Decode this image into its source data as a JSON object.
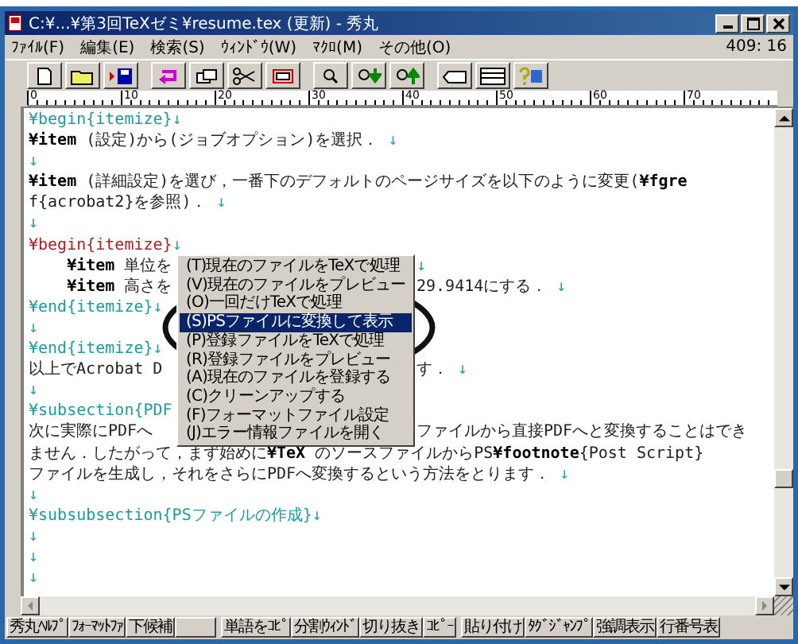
{
  "window": {
    "title": "C:¥...¥第3回TeXゼミ¥resume.tex (更新) - 秀丸"
  },
  "menu_bar": {
    "items": [
      "ﾌｧｲﾙ(F)",
      "編集(E)",
      "検索(S)",
      "ｳｨﾝﾄﾞｳ(W)",
      "ﾏｸﾛ(M)",
      "その他(O)"
    ],
    "position": "409: 16"
  },
  "ruler": {
    "marks": [
      "0",
      "10",
      "20",
      "30",
      "40",
      "50",
      "60",
      "70"
    ]
  },
  "editor": {
    "lines": [
      {
        "parts": [
          {
            "kind": "command",
            "text": "¥begin{itemize}"
          },
          {
            "kind": "return",
            "text": "↓"
          }
        ]
      },
      {
        "parts": [
          {
            "kind": "macro",
            "text": "¥item"
          },
          {
            "kind": "text",
            "text": " (設定)から(ジョブオプション)を選択． "
          },
          {
            "kind": "return",
            "text": "↓"
          }
        ]
      },
      {
        "parts": [
          {
            "kind": "return",
            "text": "↓"
          }
        ]
      },
      {
        "parts": [
          {
            "kind": "macro",
            "text": "¥item"
          },
          {
            "kind": "text",
            "text": " (詳細設定)を選び，一番下のデフォルトのページサイズを以下のように変更("
          },
          {
            "kind": "macro",
            "text": "¥fgre"
          }
        ]
      },
      {
        "parts": [
          {
            "kind": "text",
            "text": "f{acrobat2}を参照)． "
          },
          {
            "kind": "return",
            "text": "↓"
          }
        ]
      },
      {
        "parts": [
          {
            "kind": "return",
            "text": "↓"
          }
        ]
      },
      {
        "parts": [
          {
            "kind": "active",
            "text": "¥begin{itemize}"
          },
          {
            "kind": "return",
            "text": "↓"
          }
        ]
      },
      {
        "parts": [
          {
            "kind": "macro",
            "text": "    ¥item"
          },
          {
            "kind": "text",
            "text": " 単位を"
          }
        ],
        "after": [
          {
            "kind": "return",
            "text": "↓"
          }
        ]
      },
      {
        "parts": [
          {
            "kind": "macro",
            "text": "    ¥item"
          },
          {
            "kind": "text",
            "text": " 高さを"
          }
        ],
        "after": [
          {
            "kind": "text",
            "text": "29.9414にする． "
          },
          {
            "kind": "return",
            "text": "↓"
          }
        ]
      },
      {
        "parts": [
          {
            "kind": "command",
            "text": "¥end{itemize}"
          },
          {
            "kind": "return",
            "text": "↓"
          }
        ]
      },
      {
        "parts": [
          {
            "kind": "return",
            "text": "↓"
          }
        ]
      },
      {
        "parts": [
          {
            "kind": "command",
            "text": "¥end{itemize}"
          },
          {
            "kind": "return",
            "text": "↓"
          }
        ]
      },
      {
        "parts": [
          {
            "kind": "text",
            "text": "以上でAcrobat D"
          }
        ],
        "after": [
          {
            "kind": "text",
            "text": "す． "
          },
          {
            "kind": "return",
            "text": "↓"
          }
        ]
      },
      {
        "parts": [
          {
            "kind": "return",
            "text": "↓"
          }
        ]
      },
      {
        "parts": [
          {
            "kind": "command",
            "text": "¥subsection{PDF"
          }
        ]
      },
      {
        "parts": [
          {
            "kind": "text",
            "text": "次に実際にPDFへ"
          }
        ],
        "after": [
          {
            "kind": "text",
            "text": "ファイルから直接PDFへと変換することはでき"
          }
        ]
      },
      {
        "parts": [
          {
            "kind": "text",
            "text": "ません．したがって，まず始めに"
          },
          {
            "kind": "macro",
            "text": "¥TeX"
          },
          {
            "kind": "text",
            "text": " のソースファイルからPS"
          },
          {
            "kind": "macro",
            "text": "¥footnote"
          },
          {
            "kind": "text",
            "text": "{Post Script}"
          }
        ]
      },
      {
        "parts": [
          {
            "kind": "text",
            "text": "ファイルを生成し，それをさらにPDFへ変換するという方法をとります． "
          },
          {
            "kind": "return",
            "text": "↓"
          }
        ]
      },
      {
        "parts": [
          {
            "kind": "return",
            "text": "↓"
          }
        ]
      },
      {
        "parts": [
          {
            "kind": "command",
            "text": "¥subsubsection{PSファイルの作成}"
          },
          {
            "kind": "return",
            "text": "↓"
          }
        ]
      },
      {
        "parts": [
          {
            "kind": "return",
            "text": "↓"
          }
        ]
      },
      {
        "parts": [
          {
            "kind": "return",
            "text": "↓"
          }
        ]
      },
      {
        "parts": [
          {
            "kind": "return",
            "text": "↓"
          }
        ]
      }
    ]
  },
  "context_menu": {
    "items": [
      {
        "label": "(T)現在のファイルをTeXで処理",
        "selected": false
      },
      {
        "label": "(V)現在のファイルをプレビュー",
        "selected": false
      },
      {
        "label": "(O)一回だけTeXで処理",
        "selected": false
      },
      {
        "label": "(S)PSファイルに変換して表示",
        "selected": true
      },
      {
        "label": "(P)登録ファイルをTeXで処理",
        "selected": false
      },
      {
        "label": "(R)登録ファイルをプレビュー",
        "selected": false
      },
      {
        "label": "(A)現在のファイルを登録する",
        "selected": false
      },
      {
        "label": "(C)クリーンアップする",
        "selected": false
      },
      {
        "label": "(F)フォーマットファイル設定",
        "selected": false
      },
      {
        "label": "(J)エラー情報ファイルを開く",
        "selected": false
      }
    ]
  },
  "function_keys": [
    [
      {
        "kind": "key",
        "label": "秀丸ﾍﾙﾌﾟ"
      },
      {
        "kind": "key",
        "label": "ﾌｫｰﾏｯﾄﾌｧ"
      },
      {
        "kind": "key",
        "label": "下候補"
      },
      {
        "kind": "blank"
      }
    ],
    [
      {
        "kind": "key",
        "label": "単語をｺﾋﾟ"
      },
      {
        "kind": "key",
        "label": "分割ｳｨﾝﾄﾞ"
      },
      {
        "kind": "key",
        "label": "切り抜き"
      },
      {
        "kind": "key",
        "label": "ｺﾋﾟｰ"
      }
    ],
    [
      {
        "kind": "key",
        "label": "貼り付け"
      },
      {
        "kind": "key",
        "label": "ﾀｸﾞｼﾞｬﾝﾌﾟ"
      },
      {
        "kind": "key",
        "label": "強調表示"
      },
      {
        "kind": "key",
        "label": "行番号表"
      }
    ]
  ]
}
